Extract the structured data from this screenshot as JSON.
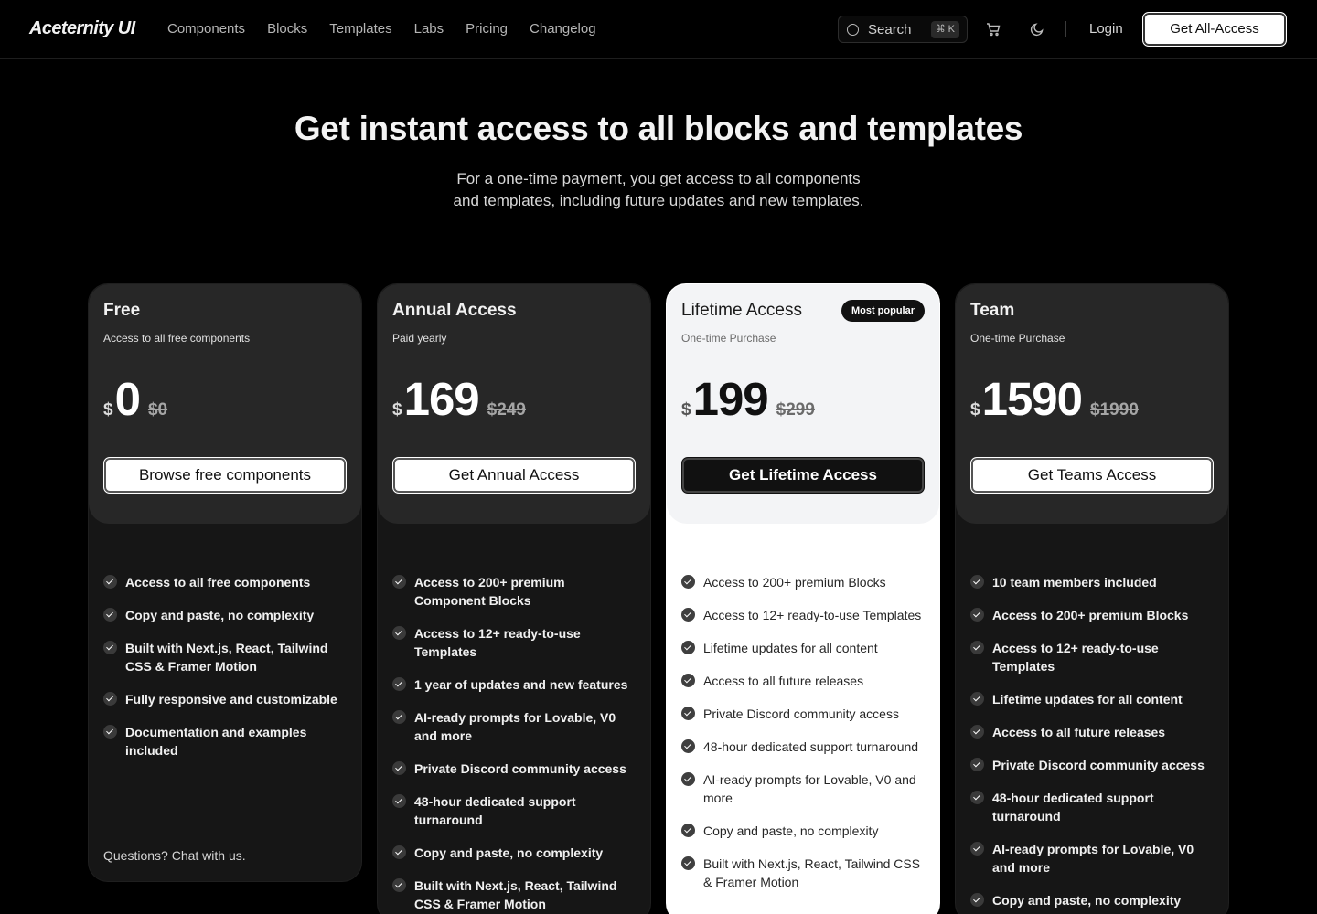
{
  "nav": {
    "logo": "Aceternity UI",
    "links": [
      "Components",
      "Blocks",
      "Templates",
      "Labs",
      "Pricing",
      "Changelog"
    ],
    "search_label": "Search",
    "search_shortcut": "⌘ K",
    "login": "Login",
    "cta": "Get All-Access"
  },
  "hero": {
    "title": "Get instant access to all blocks and templates",
    "subtitle_line1": "For a one-time payment, you get access to all components",
    "subtitle_line2": "and templates, including future updates and new templates."
  },
  "plans": [
    {
      "name": "Free",
      "desc": "Access to all free components",
      "currency": "$",
      "price": "0",
      "old_price": "$0",
      "button": "Browse free components",
      "features": [
        "Access to all free components",
        "Copy and paste, no complexity",
        "Built with Next.js, React, Tailwind CSS & Framer Motion",
        "Fully responsive and customizable",
        "Documentation and examples included"
      ],
      "footer": "Questions? Chat with us."
    },
    {
      "name": "Annual Access",
      "desc": "Paid yearly",
      "currency": "$",
      "price": "169",
      "old_price": "$249",
      "button": "Get Annual Access",
      "features": [
        "Access to 200+ premium Component Blocks",
        "Access to 12+ ready-to-use Templates",
        "1 year of updates and new features",
        "AI-ready prompts for Lovable, V0 and more",
        "Private Discord community access",
        "48-hour dedicated support turnaround",
        "Copy and paste, no complexity",
        "Built with Next.js, React, Tailwind CSS & Framer Motion"
      ]
    },
    {
      "name": "Lifetime Access",
      "badge": "Most popular",
      "desc": "One-time Purchase",
      "currency": "$",
      "price": "199",
      "old_price": "$299",
      "button": "Get Lifetime Access",
      "features": [
        "Access to 200+ premium Blocks",
        "Access to 12+ ready-to-use Templates",
        "Lifetime updates for all content",
        "Access to all future releases",
        "Private Discord community access",
        "48-hour dedicated support turnaround",
        "AI-ready prompts for Lovable, V0 and more",
        "Copy and paste, no complexity",
        "Built with Next.js, React, Tailwind CSS & Framer Motion"
      ]
    },
    {
      "name": "Team",
      "desc": "One-time Purchase",
      "currency": "$",
      "price": "1590",
      "old_price": "$1990",
      "button": "Get Teams Access",
      "features": [
        "10 team members included",
        "Access to 200+ premium Blocks",
        "Access to 12+ ready-to-use Templates",
        "Lifetime updates for all content",
        "Access to all future releases",
        "Private Discord community access",
        "48-hour dedicated support turnaround",
        "AI-ready prompts for Lovable, V0 and more",
        "Copy and paste, no complexity"
      ]
    }
  ]
}
